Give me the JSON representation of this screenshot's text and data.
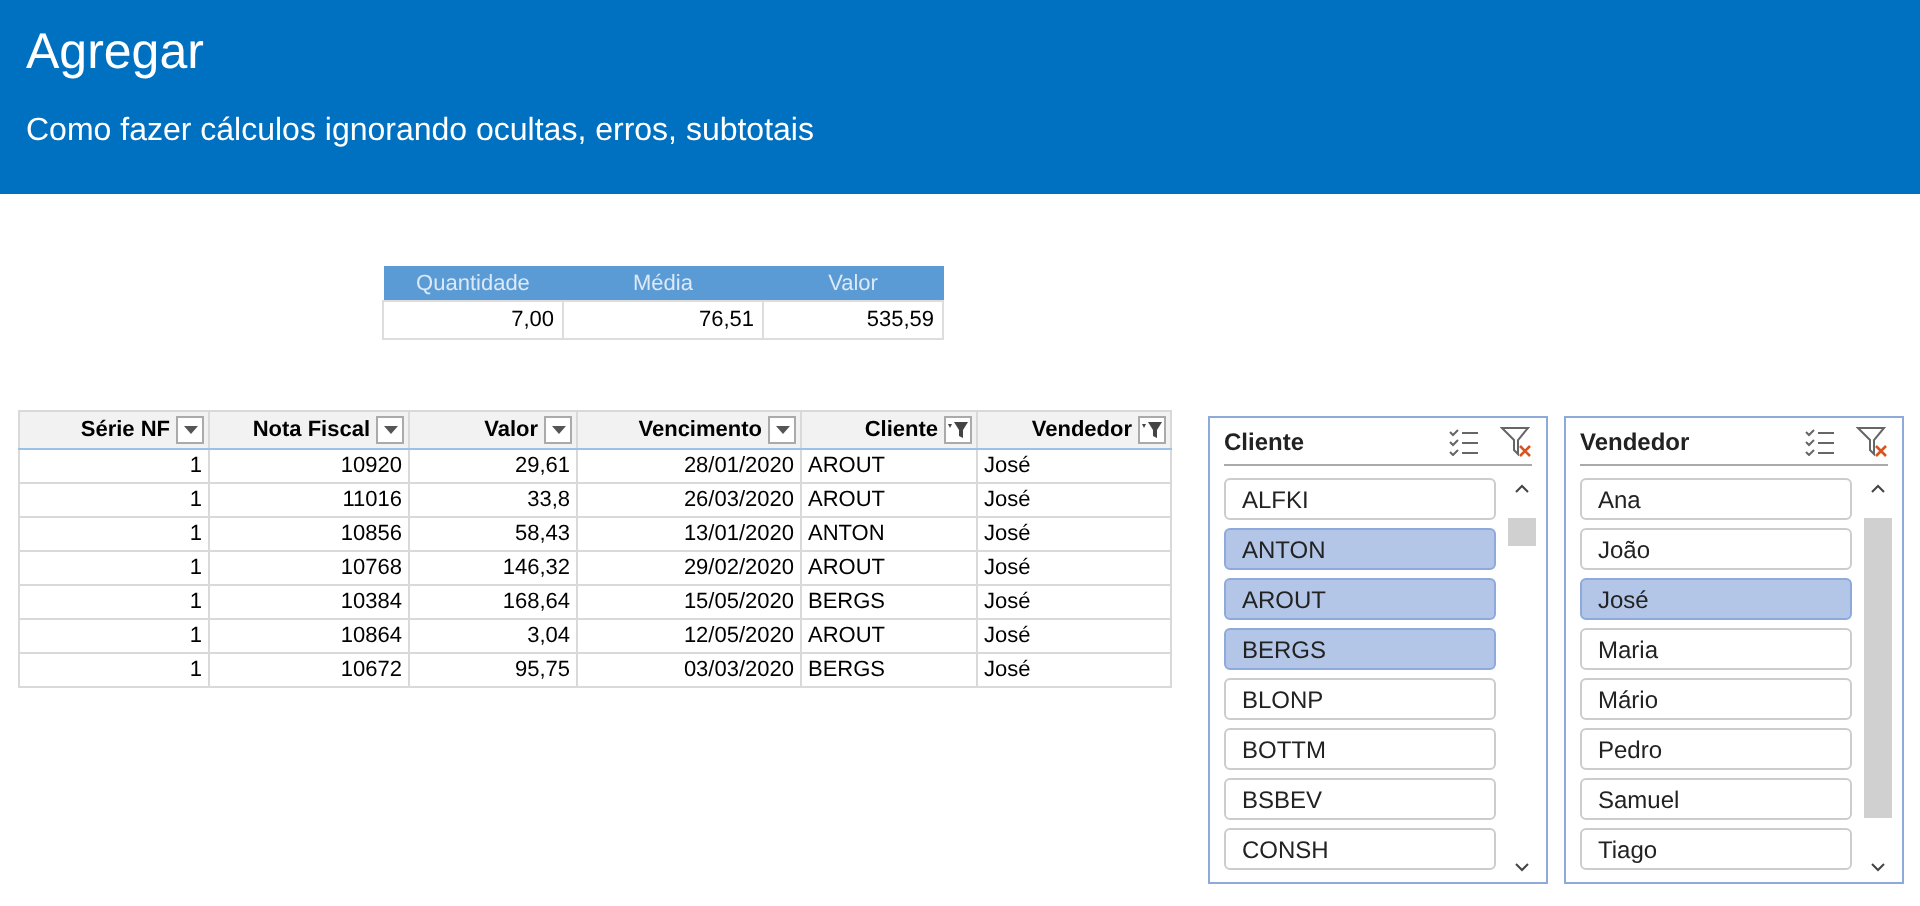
{
  "header": {
    "title": "Agregar",
    "subtitle": "Como fazer cálculos ignorando ocultas, erros, subtotais"
  },
  "summary": {
    "columns": [
      "Quantidade",
      "Média",
      "Valor"
    ],
    "values": [
      "7,00",
      "76,51",
      "535,59"
    ]
  },
  "table": {
    "columns": [
      {
        "label": "Série NF",
        "filtered": false
      },
      {
        "label": "Nota Fiscal",
        "filtered": false
      },
      {
        "label": "Valor",
        "filtered": false
      },
      {
        "label": "Vencimento",
        "filtered": false
      },
      {
        "label": "Cliente",
        "filtered": true
      },
      {
        "label": "Vendedor",
        "filtered": true
      }
    ],
    "rows": [
      [
        "1",
        "10920",
        "29,61",
        "28/01/2020",
        "AROUT",
        "José"
      ],
      [
        "1",
        "11016",
        "33,8",
        "26/03/2020",
        "AROUT",
        "José"
      ],
      [
        "1",
        "10856",
        "58,43",
        "13/01/2020",
        "ANTON",
        "José"
      ],
      [
        "1",
        "10768",
        "146,32",
        "29/02/2020",
        "AROUT",
        "José"
      ],
      [
        "1",
        "10384",
        "168,64",
        "15/05/2020",
        "BERGS",
        "José"
      ],
      [
        "1",
        "10864",
        "3,04",
        "12/05/2020",
        "AROUT",
        "José"
      ],
      [
        "1",
        "10672",
        "95,75",
        "03/03/2020",
        "BERGS",
        "José"
      ]
    ]
  },
  "slicers": [
    {
      "title": "Cliente",
      "items": [
        {
          "label": "ALFKI",
          "selected": false
        },
        {
          "label": "ANTON",
          "selected": true
        },
        {
          "label": "AROUT",
          "selected": true
        },
        {
          "label": "BERGS",
          "selected": true
        },
        {
          "label": "BLONP",
          "selected": false
        },
        {
          "label": "BOTTM",
          "selected": false
        },
        {
          "label": "BSBEV",
          "selected": false
        },
        {
          "label": "CONSH",
          "selected": false
        }
      ]
    },
    {
      "title": "Vendedor",
      "items": [
        {
          "label": "Ana",
          "selected": false
        },
        {
          "label": "João",
          "selected": false
        },
        {
          "label": "José",
          "selected": true
        },
        {
          "label": "Maria",
          "selected": false
        },
        {
          "label": "Mário",
          "selected": false
        },
        {
          "label": "Pedro",
          "selected": false
        },
        {
          "label": "Samuel",
          "selected": false
        },
        {
          "label": "Tiago",
          "selected": false
        }
      ]
    }
  ]
}
